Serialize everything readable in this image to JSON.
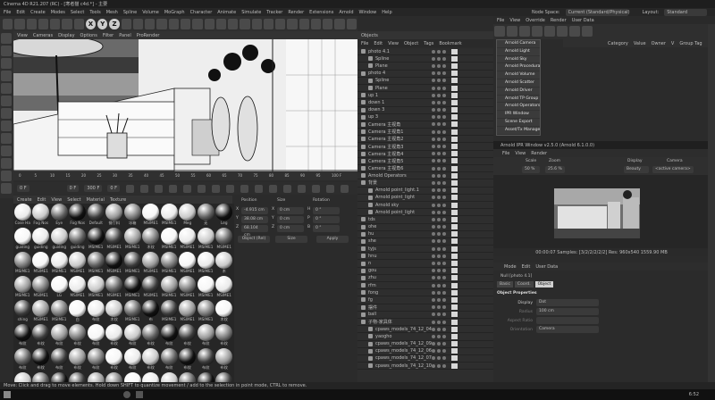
{
  "app": {
    "title": "Cinema 4D R21.207 (RC) - [寒者猫 c4d.*] - 主要",
    "menus": [
      "File",
      "Edit",
      "Create",
      "Modes",
      "Select",
      "Tools",
      "Mesh",
      "Spline",
      "Volume",
      "MoGraph",
      "Character",
      "Animate",
      "Simulate",
      "Tracker",
      "Render",
      "Extensions",
      "Arnold",
      "Window",
      "Help"
    ],
    "node_space_label": "Node Space:",
    "node_space_value": "Current (Standard/Physical)",
    "layout_label": "Layout:",
    "layout_value": "Standard",
    "mode_buttons": [
      "X",
      "Y",
      "Z"
    ]
  },
  "viewport": {
    "menus": [
      "View",
      "Cameras",
      "Display",
      "Options",
      "Filter",
      "Panel",
      "ProRender"
    ]
  },
  "timeline": {
    "ticks": [
      "0",
      "5",
      "10",
      "15",
      "20",
      "25",
      "30",
      "35",
      "40",
      "45",
      "50",
      "55",
      "60",
      "65",
      "70",
      "75",
      "80",
      "85",
      "90",
      "95",
      "100 F"
    ],
    "frame_start": "0 F",
    "frame_cur": "0 F",
    "frame_end": "300 F",
    "frame_end2": "0 F"
  },
  "materials": {
    "menus": [
      "Create",
      "Edit",
      "View",
      "Select",
      "Material",
      "Texture"
    ],
    "grid": [
      [
        "Cose Ha",
        "Fog Nos",
        "Eye",
        "Fog Nos",
        "Default",
        "餐厅料",
        "冰箱",
        "MSIME1",
        "MSIME1",
        "Meg",
        "无",
        "Leg"
      ],
      [
        "guiding",
        "guiding",
        "guiding",
        "guiding",
        "MSIME1",
        "MSIME1",
        "MSIME1",
        "木纹",
        "MSIME1",
        "MSIME1",
        "MSIME1",
        "MSIME1"
      ],
      [
        "MSIME1",
        "MSIME1",
        "MSIME1",
        "MSIME1",
        "MSIME1",
        "MSIME1",
        "MSIME1",
        "MSIME1",
        "MSIME1",
        "MSIME1",
        "MSIME1",
        "木"
      ],
      [
        "MSIME1",
        "MSIME1",
        "LG",
        "MSIME1",
        "MSIME1",
        "MSIME1",
        "MSIME1",
        "MSIME1",
        "MSIME1",
        "MSIME1",
        "MSIME1",
        "MSIME1"
      ],
      [
        "shing",
        "MSIME1",
        "MSIME1",
        "白",
        "布纹",
        "木纹",
        "MSIME1",
        "布",
        "MSIME1",
        "MSIME1",
        "MSIME1",
        "木纹"
      ],
      [
        "布纹",
        "布纹",
        "布纹",
        "布纹",
        "布纹",
        "布纹",
        "布纹",
        "布纹",
        "布纹",
        "布纹",
        "布纹",
        "布纹"
      ],
      [
        "布纹",
        "布纹",
        "布纹",
        "布纹",
        "布纹",
        "布纹",
        "布纹",
        "布纹",
        "布纹",
        "布纹",
        "布纹",
        "布纹"
      ],
      [
        "布纹",
        "布纹",
        "布纹",
        "布纹",
        "布纹",
        "布纹",
        "布纹",
        "布纹",
        "布纹",
        "布纹",
        "布纹",
        "Aine"
      ]
    ]
  },
  "coords": {
    "headers": [
      "Position",
      "Size",
      "Rotation"
    ],
    "rows": [
      [
        "X",
        "-4.915 cm",
        "X",
        "0 cm",
        "H",
        "0 °"
      ],
      [
        "Y",
        "38.08 cm",
        "Y",
        "0 cm",
        "P",
        "0 °"
      ],
      [
        "Z",
        "68.104 cm",
        "Z",
        "0 cm",
        "B",
        "0 °"
      ]
    ],
    "mode_object": "Object (Rel)",
    "mode_size": "Size",
    "apply": "Apply"
  },
  "objects": {
    "title": "Objects",
    "menus": [
      "File",
      "Edit",
      "View",
      "Object",
      "Tags",
      "Bookmark"
    ],
    "items": [
      "photo 4.1",
      "Spline",
      "Plane",
      "photo 4",
      "Spline",
      "Plane",
      "up 1",
      "down 1",
      "down 3",
      "up 3",
      "Camera 主视角",
      "Camera 主视角1",
      "Camera 主视角2",
      "Camera 主视角3",
      "Camera 主视角4",
      "Camera 主视角5",
      "Camera 主视角6",
      "Arnold Operators",
      "背景",
      "Arnold point_light.1",
      "Arnold point_light",
      "Arnold sky",
      "Arnold point_light",
      "tds",
      "ohe",
      "hu",
      "she",
      "tyjs",
      "hnu",
      "n",
      "gou",
      "zhu",
      "rfm",
      "fong",
      "fg",
      "摆件",
      "ball",
      "子物-家具体",
      "cpaws_models_74_12_04",
      "yaogho",
      "cpaws_models_74_12_09",
      "cpaws_models_74_12_06",
      "cpaws_models_74_12_07",
      "cpaws_models_74_12_10"
    ]
  },
  "rightpanel": {
    "menus": [
      "File",
      "View",
      "Override",
      "Render",
      "User Data"
    ],
    "columns": [
      "Category",
      "Value",
      "Owner",
      "V",
      "Group Tag"
    ],
    "arnold_menu": [
      "Arnold Camera",
      "Arnold Light",
      "Arnold Sky",
      "Arnold Procedural",
      "Arnold Volume",
      "Arnold Scatter",
      "Arnold Driver",
      "Arnold TP Group",
      "Arnold Operators",
      "IPR Window",
      "Scene Export",
      "Asset/Tx Manager"
    ],
    "ipr_title": "Arnold IPR Window v2.5.0 (Arnold 6.1.0.0)",
    "ipr_menus": [
      "File",
      "View",
      "Render"
    ],
    "scale_label": "Scale",
    "scale_value": "50 %",
    "zoom_label": "Zoom",
    "zoom_value": "25.6 %",
    "display_label": "Display",
    "display_value": "Beauty",
    "camera_label": "Camera",
    "camera_value": "<active camera>",
    "ipr_status": "00:00:07   Samples: [3/2/2/2/2/2]  Res: 960x540   1559.90 MB",
    "attr_menus": [
      "Mode",
      "Edit",
      "User Data"
    ],
    "attr_object": "Null [photo 4.1]",
    "attr_tabs": [
      "Basic",
      "Coord.",
      "Object"
    ],
    "attr_section": "Object Properties",
    "attr_rows": [
      [
        "Display",
        "Dot"
      ],
      [
        "Radius",
        "100 cm"
      ],
      [
        "Aspect Ratio",
        ""
      ],
      [
        "Orientation",
        "Camera"
      ]
    ]
  },
  "statusbar": {
    "text": "Move: Click and drag to move elements. Hold down SHIFT to quantize movement / add to the selection in point mode, CTRL to remove.",
    "time": "6:52"
  }
}
